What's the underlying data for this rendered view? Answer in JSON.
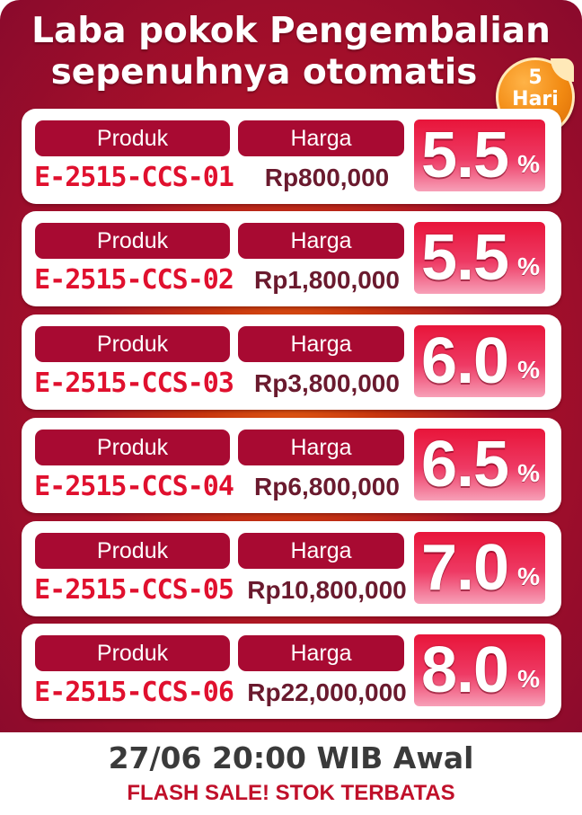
{
  "title_line1": "Laba pokok Pengembalian",
  "title_line2": "sepenuhnya otomatis",
  "badge": {
    "number": "5",
    "unit": "Hari"
  },
  "label_product": "Produk",
  "label_price": "Harga",
  "percent_sign": "%",
  "items": [
    {
      "code": "E-2515-CCS-01",
      "price": "Rp800,000",
      "rate": "5.5"
    },
    {
      "code": "E-2515-CCS-02",
      "price": "Rp1,800,000",
      "rate": "5.5"
    },
    {
      "code": "E-2515-CCS-03",
      "price": "Rp3,800,000",
      "rate": "6.0"
    },
    {
      "code": "E-2515-CCS-04",
      "price": "Rp6,800,000",
      "rate": "6.5"
    },
    {
      "code": "E-2515-CCS-05",
      "price": "Rp10,800,000",
      "rate": "7.0"
    },
    {
      "code": "E-2515-CCS-06",
      "price": "Rp22,000,000",
      "rate": "8.0"
    }
  ],
  "footer_line1": "27/06 20:00 WIB Awal",
  "footer_line2": "FLASH SALE! STOK TERBATAS",
  "colors": {
    "primary_red": "#a80a32",
    "code_red": "#e0102e",
    "badge_orange": "#f28a12"
  }
}
